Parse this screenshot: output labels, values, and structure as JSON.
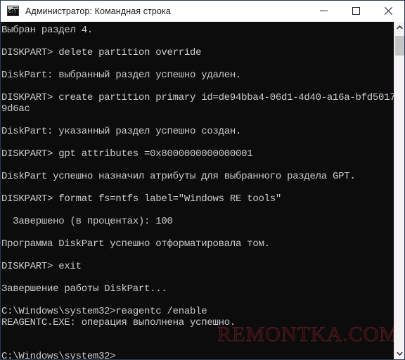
{
  "window": {
    "title": "Администратор: Командная строка",
    "icon": "console-icon",
    "icon_text": "C:\\",
    "controls": {
      "minimize": "minimize-icon",
      "maximize": "maximize-icon",
      "close": "close-icon"
    }
  },
  "console": {
    "background_color": "#0c0c0c",
    "text_color": "#ccccd0",
    "lines": [
      "Выбран раздел 4.",
      "",
      "DISKPART> delete partition override",
      "",
      "DiskPart: выбранный раздел успешно удален.",
      "",
      "DISKPART> create partition primary id=de94bba4-06d1-4d40-a16a-bfd5017",
      "9d6ac",
      "",
      "DiskPart: указанный раздел успешно создан.",
      "",
      "DISKPART> gpt attributes =0x8000000000000001",
      "",
      "DiskPart успешно назначил атрибуты для выбранного раздела GPT.",
      "",
      "DISKPART> format fs=ntfs label=\"Windows RE tools\"",
      "",
      "  Завершено (в процентах): 100",
      "",
      "Программа DiskPart успешно отформатировала том.",
      "",
      "DISKPART> exit",
      "",
      "Завершение работы DiskPart...",
      "",
      "C:\\Windows\\system32>reagentc /enable",
      "REAGENTC.EXE: операция выполнена успешно.",
      "",
      "",
      "C:\\Windows\\system32>"
    ]
  },
  "watermark": {
    "text": "REMONTKA.COM",
    "color": "#61222a"
  },
  "scrollbar": {
    "up_arrow": "chevron-up-icon",
    "down_arrow": "chevron-down-icon"
  }
}
